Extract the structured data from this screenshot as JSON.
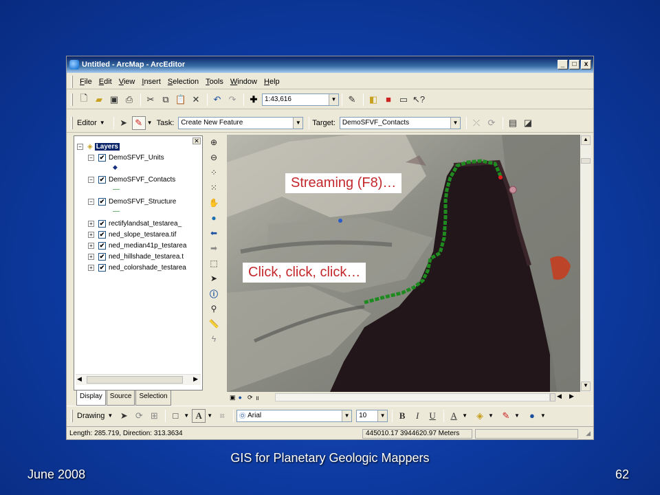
{
  "window": {
    "title": "Untitled - ArcMap - ArcEditor",
    "controls": [
      "_",
      "□",
      "x"
    ]
  },
  "menu": [
    "File",
    "Edit",
    "View",
    "Insert",
    "Selection",
    "Tools",
    "Window",
    "Help"
  ],
  "standard_toolbar": {
    "scale": "1:43,616"
  },
  "editor_toolbar": {
    "editor_label": "Editor",
    "task_label": "Task:",
    "task_value": "Create New Feature",
    "target_label": "Target:",
    "target_value": "DemoSFVF_Contacts"
  },
  "toc": {
    "root": "Layers",
    "layers": [
      {
        "name": "DemoSFVF_Units",
        "expander": "−",
        "checked": "✔",
        "symbol": "◆"
      },
      {
        "name": "DemoSFVF_Contacts",
        "expander": "−",
        "checked": "✔",
        "symbol": "—"
      },
      {
        "name": "DemoSFVF_Structure",
        "expander": "−",
        "checked": "✔",
        "symbol": "—"
      },
      {
        "name": "rectifylandsat_testarea_",
        "expander": "+",
        "checked": "✔"
      },
      {
        "name": "ned_slope_testarea.tif",
        "expander": "+",
        "checked": "✔"
      },
      {
        "name": "ned_median41p_testarea",
        "expander": "+",
        "checked": "✔"
      },
      {
        "name": "ned_hillshade_testarea.t",
        "expander": "+",
        "checked": "✔"
      },
      {
        "name": "ned_colorshade_testarea",
        "expander": "+",
        "checked": "✔"
      }
    ],
    "tabs": [
      "Display",
      "Source",
      "Selection"
    ]
  },
  "callouts": {
    "streaming": "Streaming (F8)…",
    "click": "Click, click, click…"
  },
  "drawing_toolbar": {
    "drawing_label": "Drawing",
    "font": "Arial",
    "size": "10",
    "bold": "B",
    "italic": "I",
    "underline": "U"
  },
  "status": {
    "length": "Length: 285.719, Direction: 313.3634",
    "coords": "445010.17  3944620.97 Meters"
  },
  "footer": {
    "date": "June 2008",
    "title": "GIS for Planetary Geologic Mappers",
    "page": "62"
  },
  "colors": {
    "background": "#0d3aa0",
    "callout_text": "#c3272b",
    "contact_line": "#1f8a1f"
  }
}
